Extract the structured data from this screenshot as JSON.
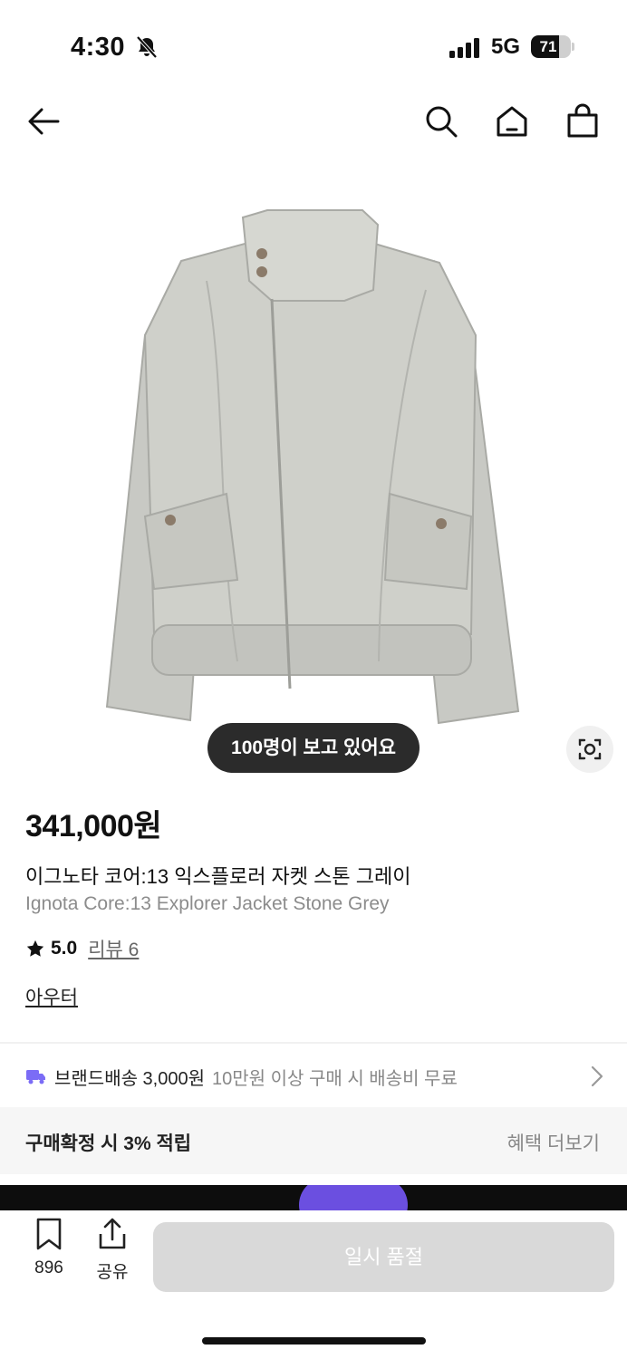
{
  "status_bar": {
    "time": "4:30",
    "network": "5G",
    "battery_level": "71",
    "battery_fraction": 0.71
  },
  "nav": {
    "back_icon": "arrow-left-icon",
    "search_icon": "search-icon",
    "home_icon": "home-icon",
    "bag_icon": "shopping-bag-icon"
  },
  "product": {
    "viewers_label": "100명이 보고 있어요",
    "price": "341,000원",
    "title_ko": "이그노타 코어:13 익스플로러 자켓 스톤 그레이",
    "title_en": "Ignota Core:13 Explorer Jacket Stone Grey",
    "rating": "5.0",
    "review_link": "리뷰 6",
    "category": "아우터"
  },
  "shipping": {
    "main": "브랜드배송 3,000원",
    "sub": "10만원 이상 구매 시 배송비 무료"
  },
  "benefit": {
    "text": "구매확정 시 3% 적립",
    "link": "혜택 더보기"
  },
  "bottom_bar": {
    "bookmark_count": "896",
    "share_label": "공유",
    "soldout_label": "일시 품절"
  },
  "colors": {
    "accent_truck": "#7b6cf6",
    "pill_bg": "#2b2b2b",
    "disabled_button": "#d9d9d9"
  }
}
